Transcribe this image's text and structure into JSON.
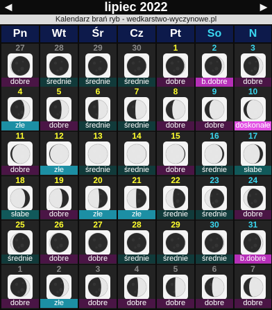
{
  "header": {
    "title": "lipiec 2022",
    "subtitle": "Kalendarz brań ryb - wedkarstwo-wyczynowe.pl",
    "prev_label": "◄",
    "next_label": "►"
  },
  "weekdays": [
    {
      "label": "Pn",
      "color": "#ffffff"
    },
    {
      "label": "Wt",
      "color": "#ffffff"
    },
    {
      "label": "Śr",
      "color": "#ffffff"
    },
    {
      "label": "Cz",
      "color": "#ffffff"
    },
    {
      "label": "Pt",
      "color": "#ffffff"
    },
    {
      "label": "So",
      "color": "#3ad7f0"
    },
    {
      "label": "N",
      "color": "#3ad7f0"
    }
  ],
  "colors": {
    "current_weekday": "#ffff2e",
    "current_weekend": "#3ad7f0",
    "other_month": "#8a8a8a",
    "rating_dobre": "#4a1545",
    "rating_srednie": "#113a3a",
    "rating_zle": "#1c8fa4",
    "rating_bdobre": "#b62fb8",
    "rating_doskonale": "#e24fe3",
    "rating_slabe": "#11595a"
  },
  "weeks": [
    [
      {
        "day": "27",
        "rating": "dobre",
        "rating_key": "dobre",
        "illum": 0.05,
        "phase": "waning",
        "current": false
      },
      {
        "day": "28",
        "rating": "średnie",
        "rating_key": "srednie",
        "illum": 0.01,
        "phase": "waning",
        "current": false
      },
      {
        "day": "29",
        "rating": "średnie",
        "rating_key": "srednie",
        "illum": 0.0,
        "phase": "new",
        "current": false
      },
      {
        "day": "30",
        "rating": "średnie",
        "rating_key": "srednie",
        "illum": 0.01,
        "phase": "waxing",
        "current": false
      },
      {
        "day": "1",
        "rating": "dobre",
        "rating_key": "dobre",
        "illum": 0.05,
        "phase": "waxing",
        "current": true
      },
      {
        "day": "2",
        "rating": "b.dobre",
        "rating_key": "bdobre",
        "illum": 0.12,
        "phase": "waxing",
        "current": true
      },
      {
        "day": "3",
        "rating": "dobre",
        "rating_key": "dobre",
        "illum": 0.2,
        "phase": "waxing",
        "current": true
      }
    ],
    [
      {
        "day": "4",
        "rating": "złe",
        "rating_key": "zle",
        "illum": 0.28,
        "phase": "waxing",
        "current": true
      },
      {
        "day": "5",
        "rating": "dobre",
        "rating_key": "dobre",
        "illum": 0.37,
        "phase": "waxing",
        "current": true
      },
      {
        "day": "6",
        "rating": "średnie",
        "rating_key": "srednie",
        "illum": 0.47,
        "phase": "waxing",
        "current": true
      },
      {
        "day": "7",
        "rating": "średnie",
        "rating_key": "srednie",
        "illum": 0.57,
        "phase": "waxing",
        "current": true
      },
      {
        "day": "8",
        "rating": "dobre",
        "rating_key": "dobre",
        "illum": 0.67,
        "phase": "waxing",
        "current": true
      },
      {
        "day": "9",
        "rating": "dobre",
        "rating_key": "dobre",
        "illum": 0.76,
        "phase": "waxing",
        "current": true
      },
      {
        "day": "10",
        "rating": "doskonałe",
        "rating_key": "doskonale",
        "illum": 0.84,
        "phase": "waxing",
        "current": true
      }
    ],
    [
      {
        "day": "11",
        "rating": "dobre",
        "rating_key": "dobre",
        "illum": 0.91,
        "phase": "waxing",
        "current": true
      },
      {
        "day": "12",
        "rating": "złe",
        "rating_key": "zle",
        "illum": 0.96,
        "phase": "waxing",
        "current": true
      },
      {
        "day": "13",
        "rating": "średnie",
        "rating_key": "srednie",
        "illum": 1.0,
        "phase": "full",
        "current": true
      },
      {
        "day": "14",
        "rating": "średnie",
        "rating_key": "srednie",
        "illum": 0.99,
        "phase": "waning",
        "current": true
      },
      {
        "day": "15",
        "rating": "dobre",
        "rating_key": "dobre",
        "illum": 0.96,
        "phase": "waning",
        "current": true
      },
      {
        "day": "16",
        "rating": "średnie",
        "rating_key": "srednie",
        "illum": 0.91,
        "phase": "waning",
        "current": true
      },
      {
        "day": "17",
        "rating": "słabe",
        "rating_key": "slabe",
        "illum": 0.84,
        "phase": "waning",
        "current": true
      }
    ],
    [
      {
        "day": "18",
        "rating": "słabe",
        "rating_key": "slabe",
        "illum": 0.76,
        "phase": "waning",
        "current": true
      },
      {
        "day": "19",
        "rating": "dobre",
        "rating_key": "dobre",
        "illum": 0.67,
        "phase": "waning",
        "current": true
      },
      {
        "day": "20",
        "rating": "złe",
        "rating_key": "zle",
        "illum": 0.57,
        "phase": "waning",
        "current": true
      },
      {
        "day": "21",
        "rating": "złe",
        "rating_key": "zle",
        "illum": 0.47,
        "phase": "waning",
        "current": true
      },
      {
        "day": "22",
        "rating": "średnie",
        "rating_key": "srednie",
        "illum": 0.37,
        "phase": "waning",
        "current": true
      },
      {
        "day": "23",
        "rating": "średnie",
        "rating_key": "srednie",
        "illum": 0.27,
        "phase": "waning",
        "current": true
      },
      {
        "day": "24",
        "rating": "dobre",
        "rating_key": "dobre",
        "illum": 0.19,
        "phase": "waning",
        "current": true
      }
    ],
    [
      {
        "day": "25",
        "rating": "średnie",
        "rating_key": "srednie",
        "illum": 0.12,
        "phase": "waning",
        "current": true
      },
      {
        "day": "26",
        "rating": "dobre",
        "rating_key": "dobre",
        "illum": 0.06,
        "phase": "waning",
        "current": true
      },
      {
        "day": "27",
        "rating": "dobre",
        "rating_key": "dobre",
        "illum": 0.02,
        "phase": "waning",
        "current": true
      },
      {
        "day": "28",
        "rating": "średnie",
        "rating_key": "srednie",
        "illum": 0.0,
        "phase": "new",
        "current": true
      },
      {
        "day": "29",
        "rating": "średnie",
        "rating_key": "srednie",
        "illum": 0.01,
        "phase": "waxing",
        "current": true
      },
      {
        "day": "30",
        "rating": "średnie",
        "rating_key": "srednie",
        "illum": 0.04,
        "phase": "waxing",
        "current": true
      },
      {
        "day": "31",
        "rating": "b.dobre",
        "rating_key": "bdobre",
        "illum": 0.1,
        "phase": "waxing",
        "current": true
      }
    ],
    [
      {
        "day": "1",
        "rating": "dobre",
        "rating_key": "dobre",
        "illum": 0.16,
        "phase": "waxing",
        "current": false
      },
      {
        "day": "2",
        "rating": "złe",
        "rating_key": "zle",
        "illum": 0.24,
        "phase": "waxing",
        "current": false
      },
      {
        "day": "3",
        "rating": "dobre",
        "rating_key": "dobre",
        "illum": 0.33,
        "phase": "waxing",
        "current": false
      },
      {
        "day": "4",
        "rating": "dobre",
        "rating_key": "dobre",
        "illum": 0.43,
        "phase": "waxing",
        "current": false
      },
      {
        "day": "5",
        "rating": "dobre",
        "rating_key": "dobre",
        "illum": 0.52,
        "phase": "waxing",
        "current": false
      },
      {
        "day": "6",
        "rating": "dobre",
        "rating_key": "dobre",
        "illum": 0.62,
        "phase": "waxing",
        "current": false
      },
      {
        "day": "7",
        "rating": "dobre",
        "rating_key": "dobre",
        "illum": 0.71,
        "phase": "waxing",
        "current": false
      }
    ]
  ]
}
